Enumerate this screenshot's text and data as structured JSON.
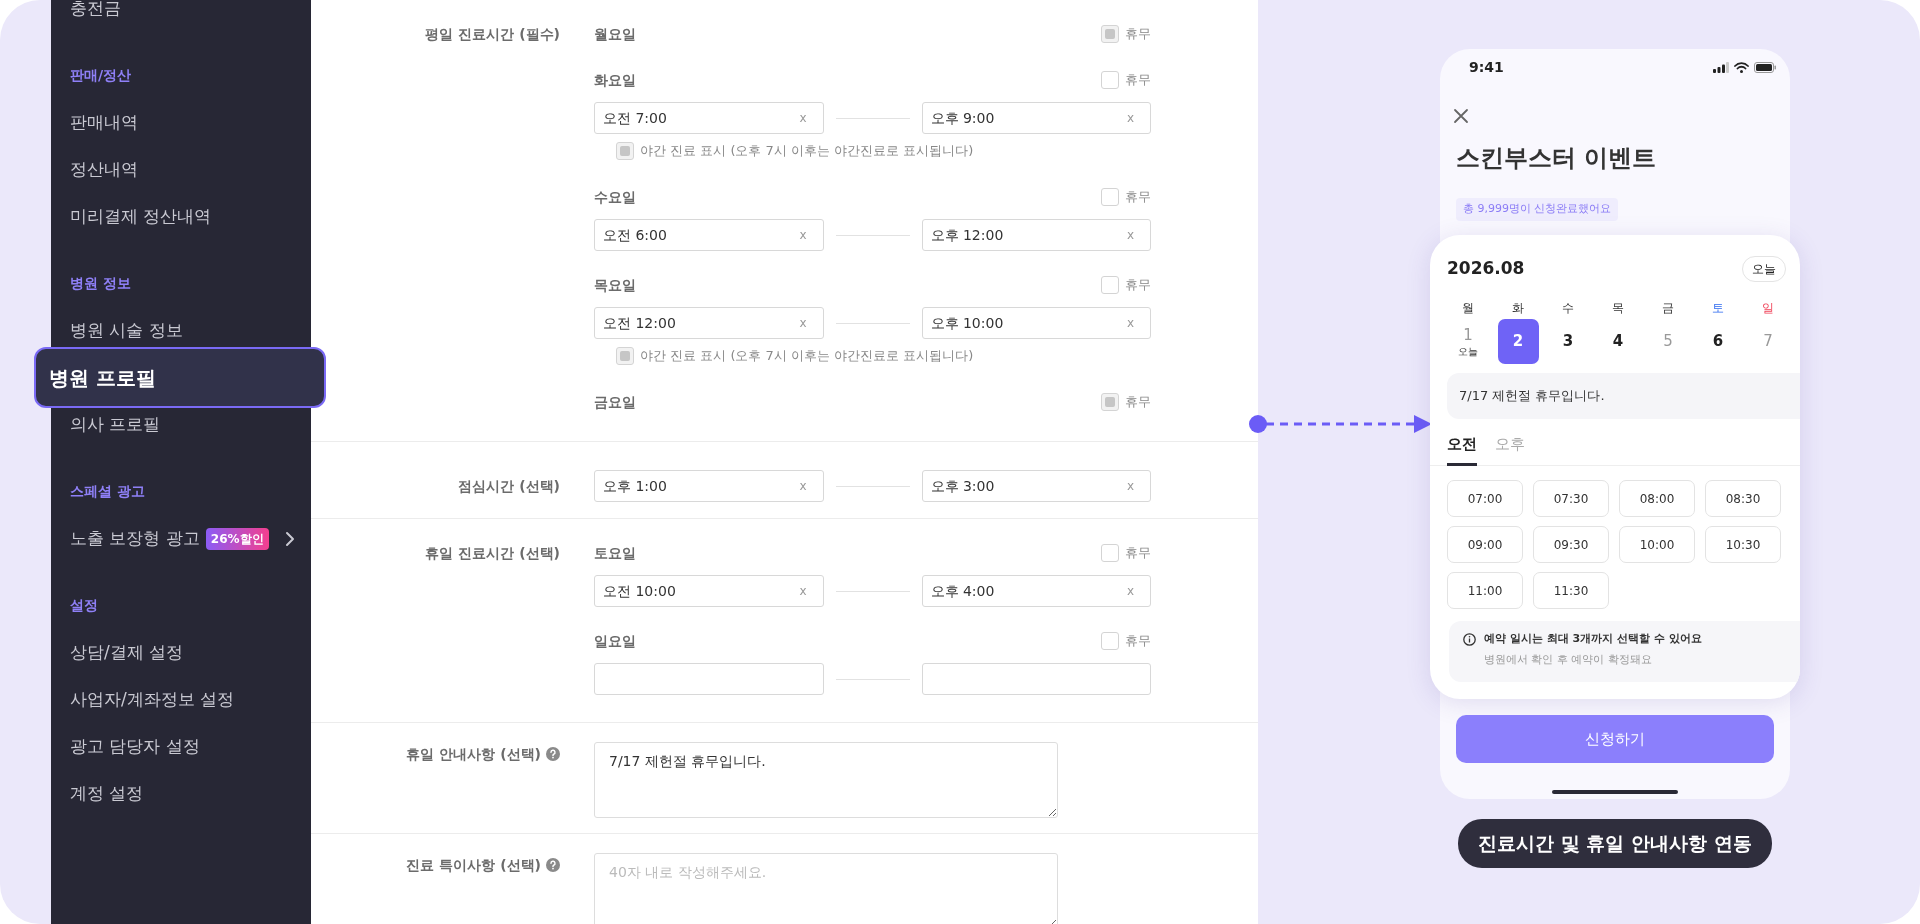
{
  "sidebar": {
    "groups": [
      {
        "items": [
          {
            "label": "충전금",
            "selected": false
          }
        ]
      },
      {
        "title": "판매/정산",
        "items": [
          {
            "label": "판매내역",
            "selected": false
          },
          {
            "label": "정산내역",
            "selected": false
          },
          {
            "label": "미리결제 정산내역",
            "selected": false
          }
        ]
      },
      {
        "title": "병원 정보",
        "items": [
          {
            "label": "병원 시술 정보",
            "selected": false
          },
          {
            "label": "병원 프로필",
            "selected": true
          },
          {
            "label": "의사 프로필",
            "selected": false
          }
        ]
      },
      {
        "title": "스페셜 광고",
        "items": [
          {
            "label": "노출 보장형 광고",
            "selected": false,
            "badge": "26%할인",
            "expandable": true
          }
        ]
      },
      {
        "title": "설정",
        "items": [
          {
            "label": "상담/결제 설정",
            "selected": false
          },
          {
            "label": "사업자/계좌정보 설정",
            "selected": false
          },
          {
            "label": "광고 담당자 설정",
            "selected": false
          },
          {
            "label": "계정 설정",
            "selected": false
          }
        ]
      }
    ]
  },
  "form": {
    "sections": [
      {
        "kind": "schedule",
        "label": "평일 진료시간 (필수)",
        "days": [
          {
            "day": "월요일",
            "closed_label": "휴무",
            "closed": true
          },
          {
            "day": "화요일",
            "closed_label": "휴무",
            "closed": false,
            "inputs": [
              {
                "kind": "time",
                "value": "오전 7:00",
                "clear": "x"
              },
              {
                "kind": "time",
                "value": "오후 9:00",
                "clear": "x"
              }
            ],
            "night": {
              "label": "야간 진료 표시 (오후 7시 이후는 야간진료로 표시됩니다)",
              "checked": true
            }
          },
          {
            "day": "수요일",
            "closed_label": "휴무",
            "closed": false,
            "inputs": [
              {
                "kind": "time",
                "value": "오전 6:00",
                "clear": "x"
              },
              {
                "kind": "time",
                "value": "오후 12:00",
                "clear": "x"
              }
            ]
          },
          {
            "day": "목요일",
            "closed_label": "휴무",
            "closed": false,
            "inputs": [
              {
                "kind": "time",
                "value": "오전 12:00",
                "clear": "x"
              },
              {
                "kind": "time",
                "value": "오후 10:00",
                "clear": "x"
              }
            ],
            "night": {
              "label": "야간 진료 표시 (오후 7시 이후는 야간진료로 표시됩니다)",
              "checked": true
            }
          },
          {
            "day": "금요일",
            "closed_label": "휴무",
            "closed": true
          }
        ]
      },
      {
        "kind": "range",
        "label": "점심시간 (선택)",
        "inputs": [
          {
            "kind": "time",
            "value": "오후 1:00",
            "clear": "x"
          },
          {
            "kind": "time",
            "value": "오후 3:00",
            "clear": "x"
          }
        ]
      },
      {
        "kind": "schedule",
        "label": "휴일 진료시간 (선택)",
        "days": [
          {
            "day": "토요일",
            "closed_label": "휴무",
            "closed": false,
            "inputs": [
              {
                "kind": "time",
                "value": "오전 10:00",
                "clear": "x"
              },
              {
                "kind": "time",
                "value": "오후 4:00",
                "clear": "x"
              }
            ]
          },
          {
            "day": "일요일",
            "closed_label": "휴무",
            "closed": false,
            "inputs": [
              {
                "kind": "empty"
              },
              {
                "kind": "empty"
              }
            ]
          }
        ]
      },
      {
        "kind": "textarea",
        "label": "휴일 안내사항 (선택)",
        "help": true,
        "value": "7/17 제헌절 휴무입니다."
      },
      {
        "kind": "textarea",
        "label": "진료 특이사항 (선택)",
        "help": true,
        "placeholder": "40자 내로 작성해주세요."
      }
    ]
  },
  "phone": {
    "time": "9:41",
    "title": "스킨부스터 이벤트",
    "badge": "총 9,999명이 신청완료했어요",
    "calendar": {
      "month": "2026.08",
      "today_button": "오늘",
      "weekdays": [
        {
          "label": "월",
          "kind": "weekday"
        },
        {
          "label": "화",
          "kind": "weekday"
        },
        {
          "label": "수",
          "kind": "weekday"
        },
        {
          "label": "목",
          "kind": "weekday"
        },
        {
          "label": "금",
          "kind": "weekday"
        },
        {
          "label": "토",
          "kind": "saturday"
        },
        {
          "label": "일",
          "kind": "sunday"
        }
      ],
      "dates": [
        {
          "label": "1",
          "sub": "오늘",
          "selected": false,
          "disabled": true
        },
        {
          "label": "2",
          "selected": true,
          "disabled": false
        },
        {
          "label": "3",
          "selected": false,
          "disabled": false
        },
        {
          "label": "4",
          "selected": false,
          "disabled": false
        },
        {
          "label": "5",
          "selected": false,
          "disabled": true
        },
        {
          "label": "6",
          "selected": false,
          "disabled": false
        },
        {
          "label": "7",
          "selected": false,
          "disabled": true
        }
      ],
      "notice": "7/17 제헌절 휴무입니다.",
      "tabs": [
        {
          "label": "오전",
          "selected": true
        },
        {
          "label": "오후",
          "selected": false
        }
      ],
      "slots": [
        "07:00",
        "07:30",
        "08:00",
        "08:30",
        "09:00",
        "09:30",
        "10:00",
        "10:30",
        "11:00",
        "11:30"
      ],
      "info": {
        "title": "예약 일시는 최대 3개까지 선택할 수 있어요",
        "text": "병원에서 확인 후 예약이 확정돼요"
      }
    },
    "submit": "신청하기"
  },
  "caption": "진료시간 및 휴일 안내사항 연동"
}
